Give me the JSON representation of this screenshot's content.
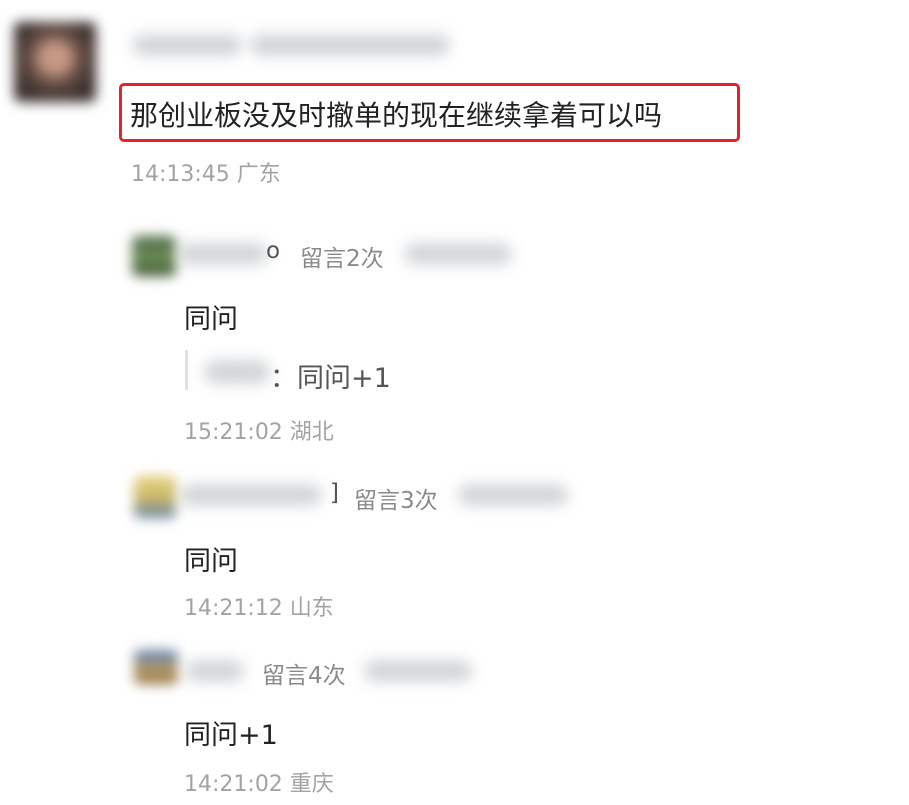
{
  "comments": [
    {
      "content": "那创业板没及时撤单的现在继续拿着可以吗",
      "time_location": "14:13:45 广东"
    }
  ],
  "replies": [
    {
      "name_suffix": "o",
      "count_label": "留言2次",
      "content": "同问",
      "quote_text": "：同问+1",
      "time_location": "15:21:02 湖北"
    },
    {
      "name_suffix": "]",
      "count_label": "留言3次",
      "content": "同问",
      "time_location": "14:21:12 山东"
    },
    {
      "name_suffix": "",
      "count_label": "留言4次",
      "content": "同问+1",
      "time_location": "14:21:02 重庆"
    }
  ],
  "colors": {
    "highlight_border": "#e8202a",
    "meta_gray": "#8a8a8a",
    "time_gray": "#a3a3a3"
  }
}
